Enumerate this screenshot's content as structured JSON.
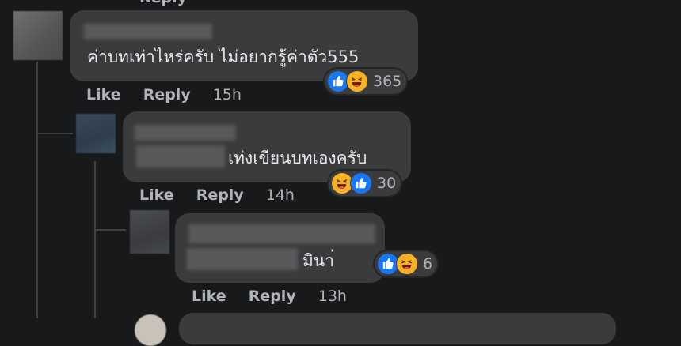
{
  "top_partial": {
    "reply_label": "Reply"
  },
  "comments": [
    {
      "text": "ค่าบทเท่าไหร่ครับ ไม่อยากรู้ค่าตัว555",
      "reaction_count": "365",
      "reactions": [
        "like",
        "haha"
      ],
      "like_label": "Like",
      "reply_label": "Reply",
      "time": "15h"
    },
    {
      "text": "เท่งเขียนบทเองครับ",
      "reaction_count": "30",
      "reactions": [
        "haha",
        "like"
      ],
      "like_label": "Like",
      "reply_label": "Reply",
      "time": "14h"
    },
    {
      "text": "มินา่",
      "reaction_count": "6",
      "reactions": [
        "like",
        "haha"
      ],
      "like_label": "Like",
      "reply_label": "Reply",
      "time": "13h"
    }
  ],
  "colors": {
    "background": "#18191a",
    "bubble": "#3a3b3c",
    "like_blue": "#1877f2",
    "haha_yellow": "#f7b125",
    "secondary_text": "#b0b3b8"
  }
}
